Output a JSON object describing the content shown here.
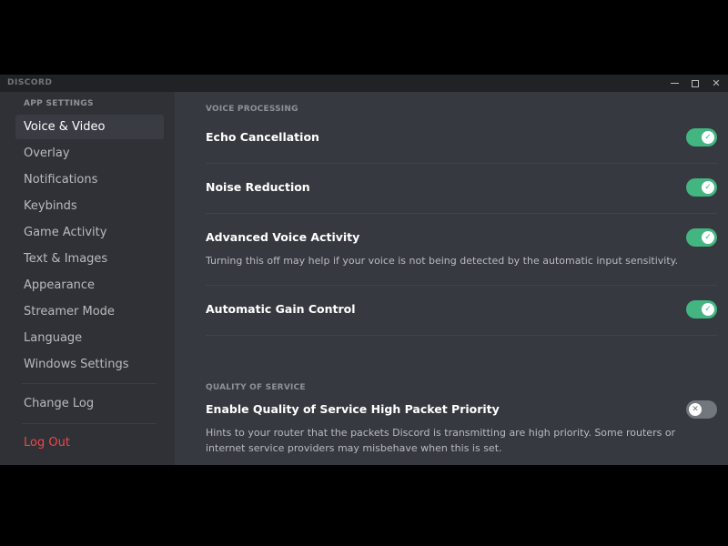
{
  "window": {
    "brand": "DISCORD",
    "controls": {
      "minimize": "minimize-icon",
      "maximize": "maximize-icon",
      "close": "close-icon"
    }
  },
  "sidebar": {
    "header": "APP SETTINGS",
    "items": [
      {
        "label": "Voice & Video",
        "active": true
      },
      {
        "label": "Overlay"
      },
      {
        "label": "Notifications"
      },
      {
        "label": "Keybinds"
      },
      {
        "label": "Game Activity"
      },
      {
        "label": "Text & Images"
      },
      {
        "label": "Appearance"
      },
      {
        "label": "Streamer Mode"
      },
      {
        "label": "Language"
      },
      {
        "label": "Windows Settings"
      }
    ],
    "changelog": "Change Log",
    "logout": "Log Out"
  },
  "content": {
    "voice_processing": {
      "title": "VOICE PROCESSING",
      "settings": [
        {
          "label": "Echo Cancellation",
          "enabled": true,
          "icon": "check-icon"
        },
        {
          "label": "Noise Reduction",
          "enabled": true,
          "icon": "check-icon"
        },
        {
          "label": "Advanced Voice Activity",
          "enabled": true,
          "icon": "check-icon",
          "description": "Turning this off may help if your voice is not being detected by the automatic input sensitivity."
        },
        {
          "label": "Automatic Gain Control",
          "enabled": true,
          "icon": "check-icon"
        }
      ]
    },
    "quality_of_service": {
      "title": "QUALITY OF SERVICE",
      "settings": [
        {
          "label": "Enable Quality of Service High Packet Priority",
          "enabled": false,
          "icon": "x-icon",
          "description": "Hints to your router that the packets Discord is transmitting are high priority. Some routers or internet service providers may misbehave when this is set."
        }
      ]
    }
  },
  "colors": {
    "toggle_on": "#43b581",
    "toggle_off": "#72767d",
    "logout": "#f04747",
    "background": "#36393f",
    "sidebar": "#2f3136"
  }
}
